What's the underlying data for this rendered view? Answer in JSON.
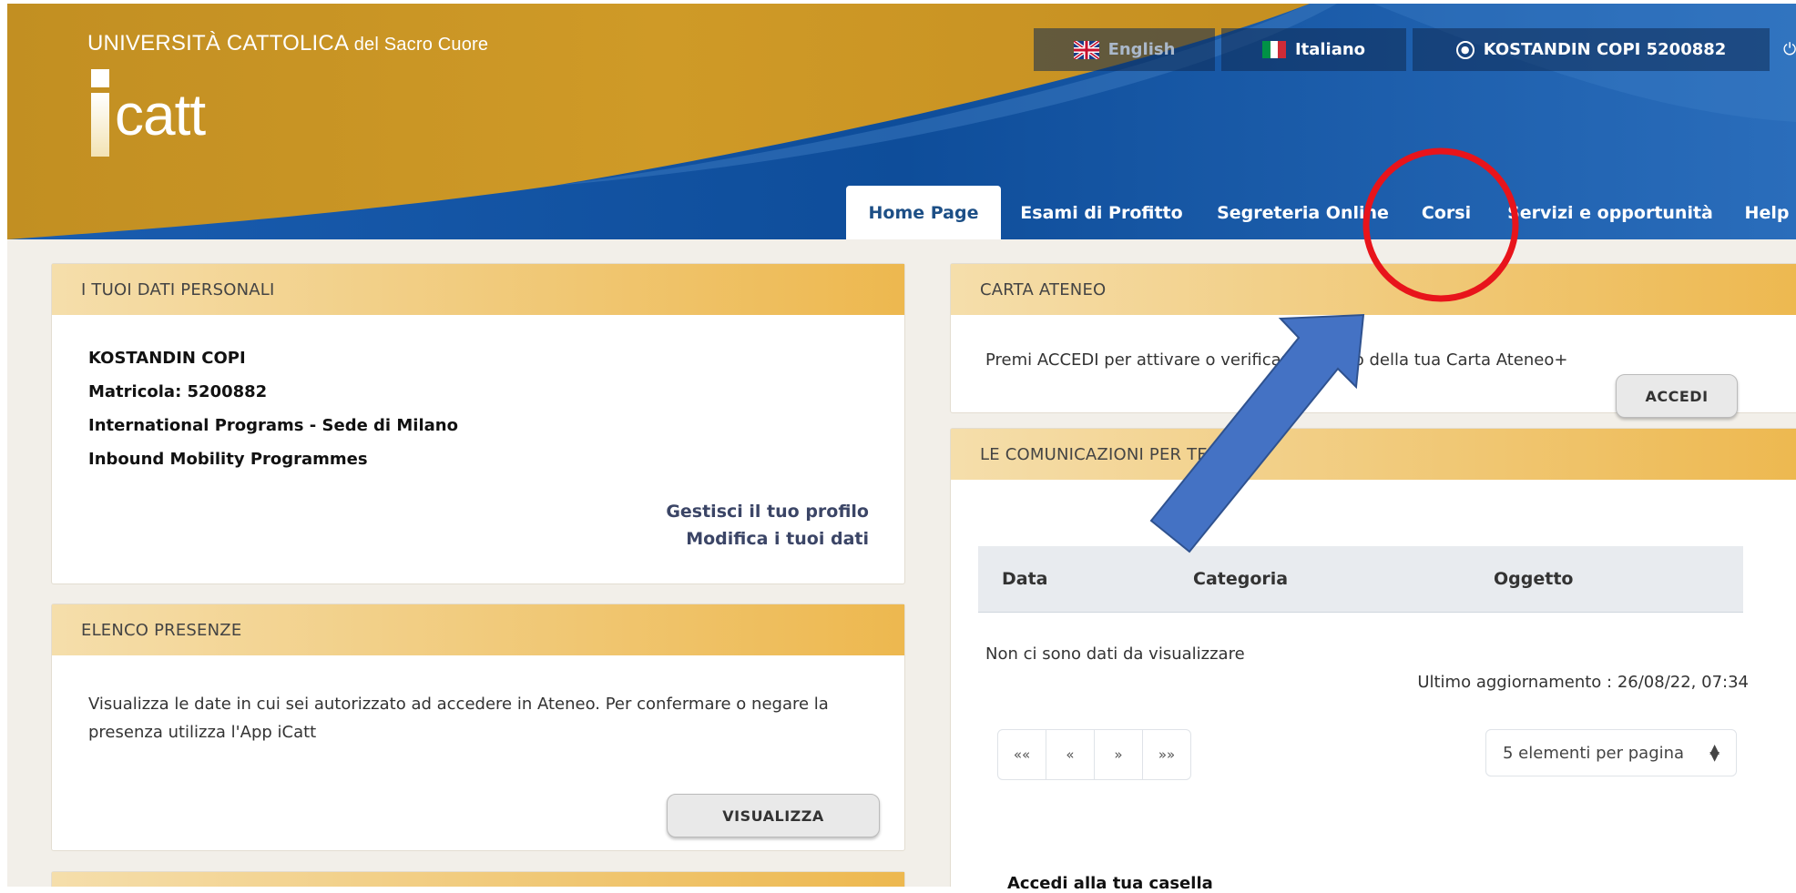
{
  "header": {
    "university_name": "UNIVERSITÀ CATTOLICA",
    "university_suffix": "del Sacro Cuore",
    "logo_text": "catt",
    "languages": {
      "english": "English",
      "italian": "Italiano"
    },
    "user": "KOSTANDIN COPI 5200882"
  },
  "nav": {
    "tabs": [
      {
        "label": "Home Page"
      },
      {
        "label": "Esami di Profitto"
      },
      {
        "label": "Segreteria Online"
      },
      {
        "label": "Corsi"
      },
      {
        "label": "Servizi e opportunità"
      },
      {
        "label": "Help"
      }
    ],
    "active": "Home Page"
  },
  "personal": {
    "title": "I TUOI DATI PERSONALI",
    "name": "KOSTANDIN COPI",
    "matricola": "Matricola: 5200882",
    "program": "International Programs - Sede di Milano",
    "mobility": "Inbound Mobility Programmes",
    "link_profile": "Gestisci il tuo profilo",
    "link_edit": "Modifica i tuoi dati"
  },
  "presenze": {
    "title": "ELENCO PRESENZE",
    "text": "Visualizza le date in cui sei autorizzato ad accedere in Ateneo. Per confermare o negare la presenza utilizza l'App iCatt",
    "button": "VISUALIZZA"
  },
  "carta": {
    "title": "CARTA ATENEO",
    "text": "Premi ACCEDI per attivare o verificare lo stato della tua Carta Ateneo+",
    "button": "ACCEDI"
  },
  "comunicazioni": {
    "title": "LE COMUNICAZIONI PER TE",
    "columns": [
      "Data",
      "Categoria",
      "Oggetto"
    ],
    "empty": "Non ci sono dati da visualizzare",
    "updated": "Ultimo aggiornamento : 26/08/22, 07:34",
    "pager": [
      "««",
      "«",
      "»",
      "»»"
    ],
    "per_page": "5 elementi per pagina",
    "mail_link": "Accedi alla tua casella"
  },
  "annotation": {
    "circle_color": "#e8141b",
    "arrow_color": "#4472c4"
  }
}
